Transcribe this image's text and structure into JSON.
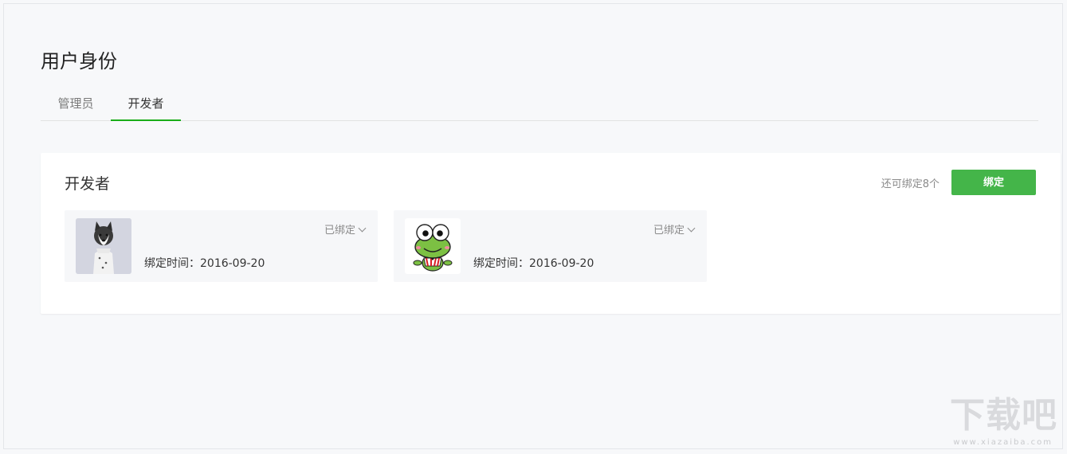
{
  "page": {
    "title": "用户身份"
  },
  "tabs": [
    {
      "label": "管理员",
      "active": false
    },
    {
      "label": "开发者",
      "active": true
    }
  ],
  "panel": {
    "title": "开发者",
    "remaining_text": "还可绑定8个",
    "bind_button_label": "绑定"
  },
  "users": [
    {
      "avatar": "husky-dog-photo",
      "status": "已绑定",
      "bind_time": "绑定时间：2016-09-20"
    },
    {
      "avatar": "green-frog-cartoon",
      "status": "已绑定",
      "bind_time": "绑定时间：2016-09-20"
    }
  ],
  "watermark": {
    "text": "下载吧",
    "sub": "www.xiazaiba.com"
  },
  "colors": {
    "accent": "#44b549",
    "tab_active_underline": "#1aad19",
    "background": "#f7f8fa"
  }
}
